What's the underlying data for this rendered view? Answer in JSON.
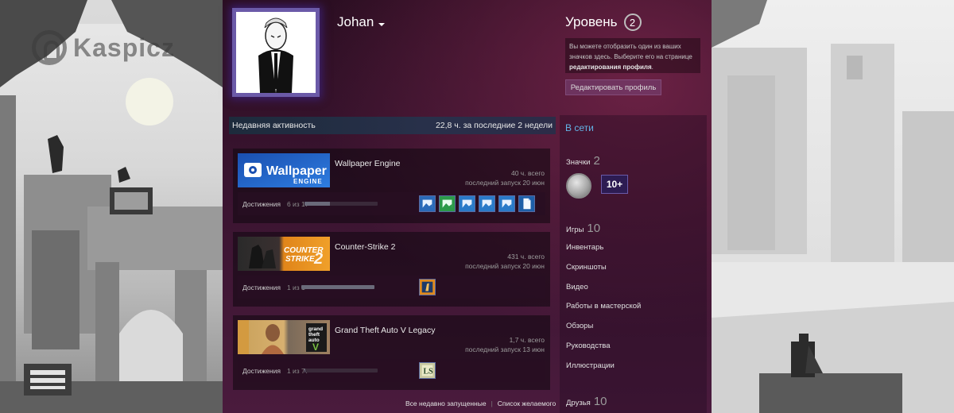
{
  "watermark": "Kaspicz",
  "profile": {
    "persona_name": "Johan",
    "level_label": "Уровень",
    "level_value": "2",
    "level_note_1": "Вы можете отобразить один из ваших значков здесь. Выберите его на странице ",
    "level_note_link": "редактирования профиля",
    "level_note_end": ".",
    "edit_button": "Редактировать профиль"
  },
  "recent": {
    "title": "Недавняя активность",
    "hours_summary": "22,8 ч. за последние 2 недели",
    "games": [
      {
        "name": "Wallpaper Engine",
        "total": "40 ч. всего",
        "last": "последний запуск 20 июн",
        "ach_label": "Достижения",
        "ach_count": "6 из 17",
        "ach_fraction": 0.35,
        "capsule_icon": "wallpaper-engine-logo",
        "capsule_text_1": "Wallpaper",
        "capsule_text_2": "ENGINE",
        "achievement_icons": [
          "image-icon",
          "image-icon",
          "image-icon",
          "image-icon",
          "image-icon",
          "document-icon"
        ]
      },
      {
        "name": "Counter-Strike 2",
        "total": "431 ч. всего",
        "last": "последний запуск 20 июн",
        "ach_label": "Достижения",
        "ach_count": "1 из 1",
        "ach_fraction": 1.0,
        "capsule_icon": "counter-strike-logo",
        "capsule_text_1": "COUNTER",
        "capsule_text_2": "STRIKE",
        "capsule_text_3": "2",
        "achievement_icons": [
          "cs-achievement-icon"
        ]
      },
      {
        "name": "Grand Theft Auto V Legacy",
        "total": "1,7 ч. всего",
        "last": "последний запуск 13 июн",
        "ach_label": "Достижения",
        "ach_count": "1 из 77",
        "ach_fraction": 0.013,
        "capsule_icon": "gta-v-logo",
        "capsule_text_1": "grand",
        "capsule_text_2": "theft",
        "capsule_text_3": "auto",
        "capsule_text_4": "V",
        "achievement_icons": [
          "ls-achievement-icon"
        ]
      }
    ],
    "links": [
      "Все недавно запущенные",
      "Список желаемого"
    ]
  },
  "side": {
    "status": "В сети",
    "badges_label": "Значки",
    "badges_count": "2",
    "badge_tenplus": "10+",
    "games_label": "Игры",
    "games_count": "10",
    "items": [
      "Инвентарь",
      "Скриншоты",
      "Видео",
      "Работы в мастерской",
      "Обзоры",
      "Руководства",
      "Иллюстрации"
    ],
    "friends_label": "Друзья",
    "friends_count": "10"
  },
  "colors": {
    "online_blue": "#63b4e6",
    "profile_bg": "#3a1430",
    "edit_button": "#785078"
  }
}
